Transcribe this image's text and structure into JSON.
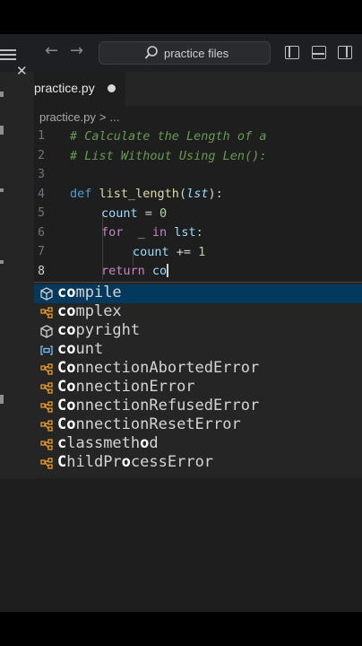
{
  "titlebar": {
    "search_text": "practice files"
  },
  "tab": {
    "filename": "practice.py"
  },
  "breadcrumb": {
    "file": "practice.py",
    "sep": ">",
    "more": "..."
  },
  "editor": {
    "line_numbers": [
      "1",
      "2",
      "3",
      "4",
      "5",
      "6",
      "7",
      "8"
    ],
    "lines": {
      "l1_comment": "# Calculate the Length of a",
      "l2_comment": "# List Without Using Len():",
      "l4_def": "def",
      "l4_fn": "list_length",
      "l4_open": "(",
      "l4_param": "lst",
      "l4_close": "):",
      "l5_var": "count",
      "l5_eq": " = ",
      "l5_num": "0",
      "l6_for": "for",
      "l6_mid": "  _ ",
      "l6_in": "in",
      "l6_rest": " lst:",
      "l7_var": "count",
      "l7_op": " += ",
      "l7_num": "1",
      "l8_return": "return",
      "l8_typed": " co"
    }
  },
  "suggestions": [
    {
      "match": "co",
      "rest": "mpile",
      "icon": "cube-icon",
      "icon_color": "#cccccc"
    },
    {
      "match": "co",
      "rest": "mplex",
      "icon": "class-icon",
      "icon_color": "#ee9d28"
    },
    {
      "match": "co",
      "rest": "pyright",
      "icon": "cube-icon",
      "icon_color": "#cccccc"
    },
    {
      "match": "co",
      "rest": "unt",
      "icon": "variable-icon",
      "icon_color": "#75beff"
    },
    {
      "match_parts": [
        "Co",
        "nnectionAbortedError"
      ],
      "icon": "class-icon",
      "icon_color": "#ee9d28"
    },
    {
      "match_parts": [
        "Co",
        "nnectionError"
      ],
      "icon": "class-icon",
      "icon_color": "#ee9d28"
    },
    {
      "match_parts": [
        "Co",
        "nnectionRefusedError"
      ],
      "icon": "class-icon",
      "icon_color": "#ee9d28"
    },
    {
      "match_parts": [
        "Co",
        "nnectionResetError"
      ],
      "icon": "class-icon",
      "icon_color": "#ee9d28"
    },
    {
      "match_parts": [
        "c",
        "lassmeth",
        "o",
        "d"
      ],
      "icon": "class-icon",
      "icon_color": "#ee9d28"
    },
    {
      "match_parts": [
        "C",
        "hildPr",
        "o",
        "cessError"
      ],
      "icon": "class-icon",
      "icon_color": "#ee9d28"
    }
  ],
  "colors": {
    "editor_bg": "#1e1e1e",
    "selection_bg": "#04395e",
    "comment": "#6a9955",
    "keyword": "#569cd6",
    "function": "#dcdcaa"
  }
}
